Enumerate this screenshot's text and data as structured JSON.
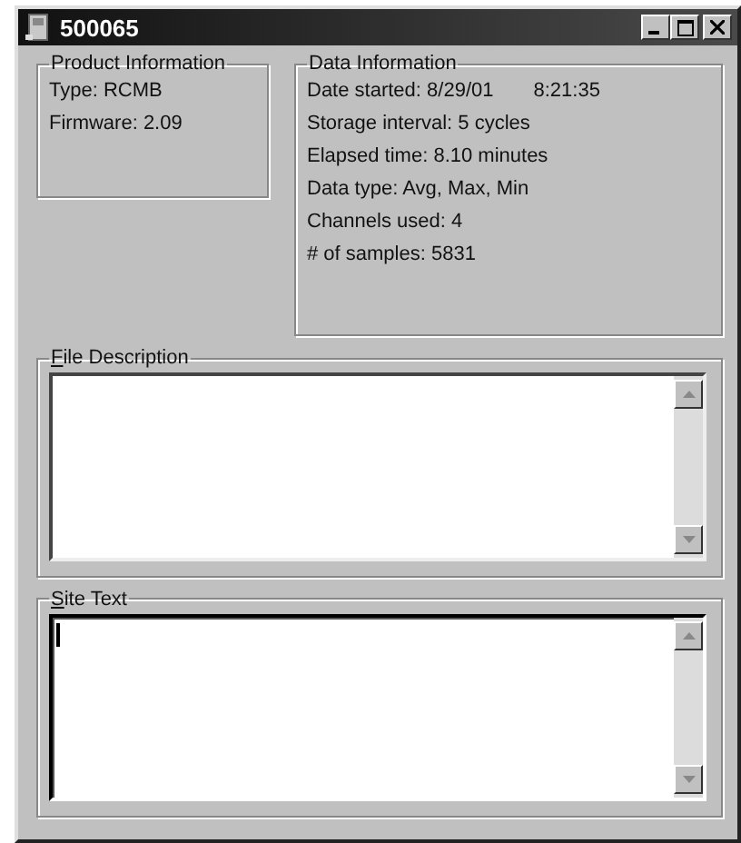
{
  "window": {
    "title": "500065"
  },
  "product_information": {
    "title": "Product Information",
    "lines": [
      "Type:  RCMB",
      "Firmware:  2.09"
    ]
  },
  "data_information": {
    "title": "Data Information",
    "lines": [
      [
        "Date started: 8/29/01",
        "8:21:35"
      ],
      [
        "Storage interval: 5 cycles"
      ],
      [
        "Elapsed time:  8.10 minutes"
      ],
      [
        "Data type: Avg, Max, Min"
      ],
      [
        "Channels used: 4"
      ],
      [
        "# of samples:  5831"
      ]
    ]
  },
  "text_areas": [
    {
      "label": "File Description",
      "focused": false
    },
    {
      "label": "Site Text",
      "focused": true
    }
  ]
}
